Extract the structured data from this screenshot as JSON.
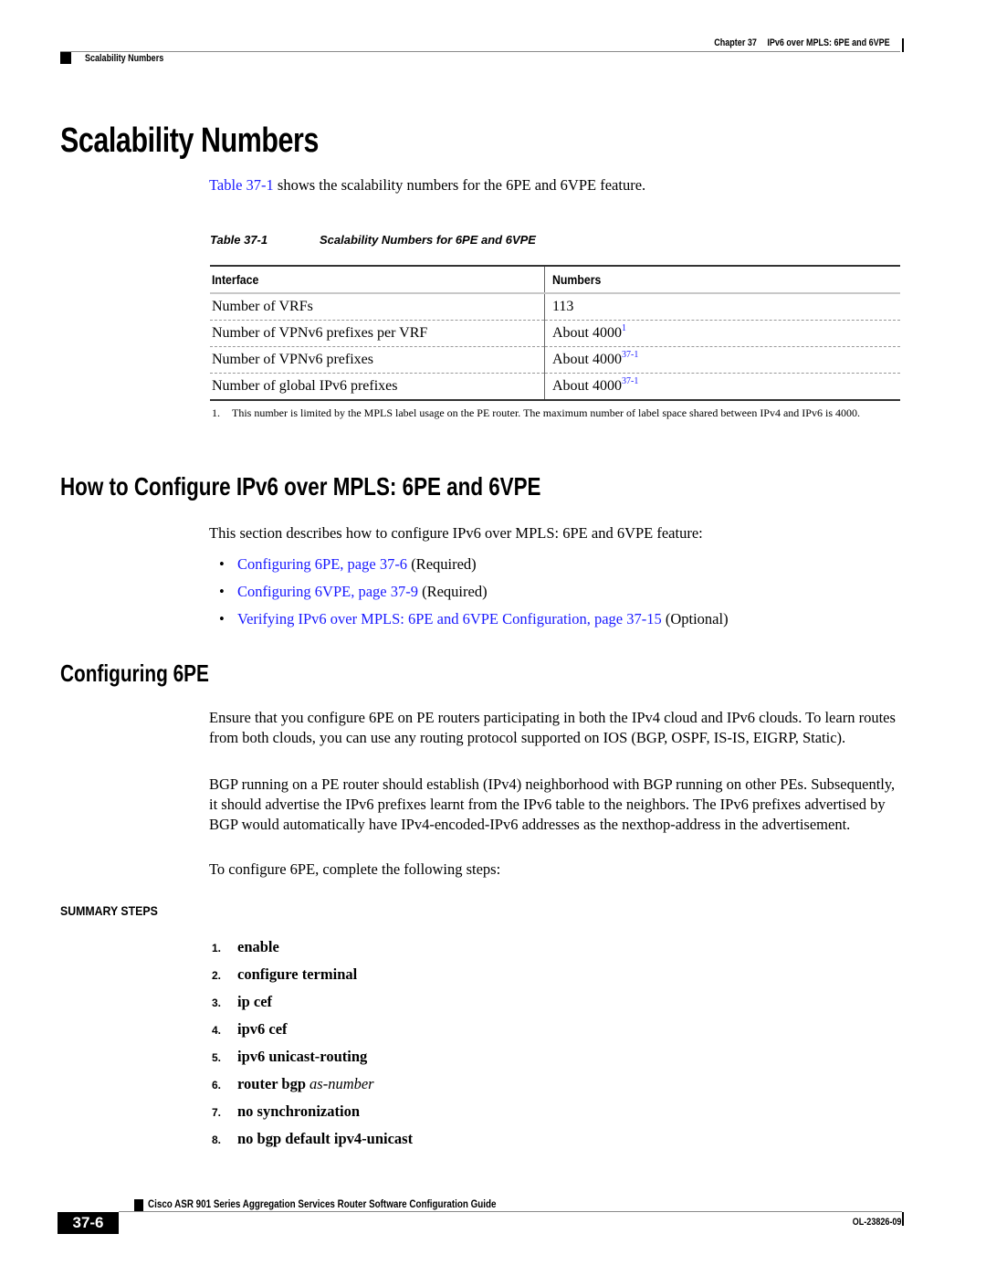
{
  "header": {
    "chapter_label": "Chapter 37",
    "chapter_title": "IPv6 over MPLS: 6PE and 6VPE",
    "section": "Scalability Numbers"
  },
  "section1": {
    "title": "Scalability Numbers",
    "intro_link": "Table 37-1",
    "intro_text": " shows the scalability numbers for the 6PE and 6VPE feature."
  },
  "table": {
    "caption_num": "Table 37-1",
    "caption_title": "Scalability Numbers for 6PE and 6VPE",
    "headers": [
      "Interface",
      "Numbers"
    ],
    "rows": [
      {
        "interface": "Number of VRFs",
        "number": "113",
        "note": ""
      },
      {
        "interface": "Number of VPNv6 prefixes per VRF",
        "number": "About 4000",
        "note": "1"
      },
      {
        "interface": "Number of VPNv6 prefixes",
        "number": "About 4000",
        "note": "37-1"
      },
      {
        "interface": "Number of global IPv6 prefixes",
        "number": "About 4000",
        "note": "37-1"
      }
    ],
    "footnote_num": "1.",
    "footnote_text": "This number is limited by the MPLS label usage on the PE router. The maximum number of label space shared between IPv4 and IPv6 is 4000."
  },
  "section2": {
    "title": "How to Configure IPv6 over MPLS: 6PE and 6VPE",
    "intro": "This section describes how to configure IPv6 over MPLS: 6PE and 6VPE feature:",
    "bullet_glyph": "•",
    "bullets": [
      {
        "link": "Configuring 6PE, page 37-6",
        "suffix": " (Required)"
      },
      {
        "link": "Configuring 6VPE, page 37-9",
        "suffix": " (Required)"
      },
      {
        "link": "Verifying IPv6 over MPLS: 6PE and 6VPE Configuration, page 37-15",
        "suffix": " (Optional)"
      }
    ]
  },
  "section3": {
    "title": "Configuring 6PE",
    "para1": "Ensure that you configure 6PE on PE routers participating in both the IPv4 cloud and IPv6 clouds. To learn routes from both clouds, you can use any routing protocol supported on IOS (BGP, OSPF, IS-IS, EIGRP, Static).",
    "para2": "BGP running on a PE router should establish (IPv4) neighborhood with BGP running on other PEs. Subsequently, it should advertise the IPv6 prefixes learnt from the IPv6 table to the neighbors. The IPv6 prefixes advertised by BGP would automatically have IPv4-encoded-IPv6 addresses as the nexthop-address in the advertisement.",
    "para3": "To configure 6PE, complete the following steps:"
  },
  "summary": {
    "heading": "SUMMARY STEPS",
    "steps": [
      {
        "num": "1.",
        "cmd": "enable",
        "arg": ""
      },
      {
        "num": "2.",
        "cmd": "configure terminal",
        "arg": ""
      },
      {
        "num": "3.",
        "cmd": "ip cef",
        "arg": ""
      },
      {
        "num": "4.",
        "cmd": "ipv6 cef",
        "arg": ""
      },
      {
        "num": "5.",
        "cmd": "ipv6 unicast-routing",
        "arg": ""
      },
      {
        "num": "6.",
        "cmd": "router bgp",
        "arg": "as-number"
      },
      {
        "num": "7.",
        "cmd": "no synchronization",
        "arg": ""
      },
      {
        "num": "8.",
        "cmd": "no bgp default ipv4-unicast",
        "arg": ""
      }
    ]
  },
  "footer": {
    "guide_title": "Cisco ASR 901 Series Aggregation Services Router Software Configuration Guide",
    "page_number": "37-6",
    "doc_id": "OL-23826-09"
  },
  "colors": {
    "link": "#1a1aff",
    "text": "#000000",
    "rule": "#8a8a8a"
  }
}
